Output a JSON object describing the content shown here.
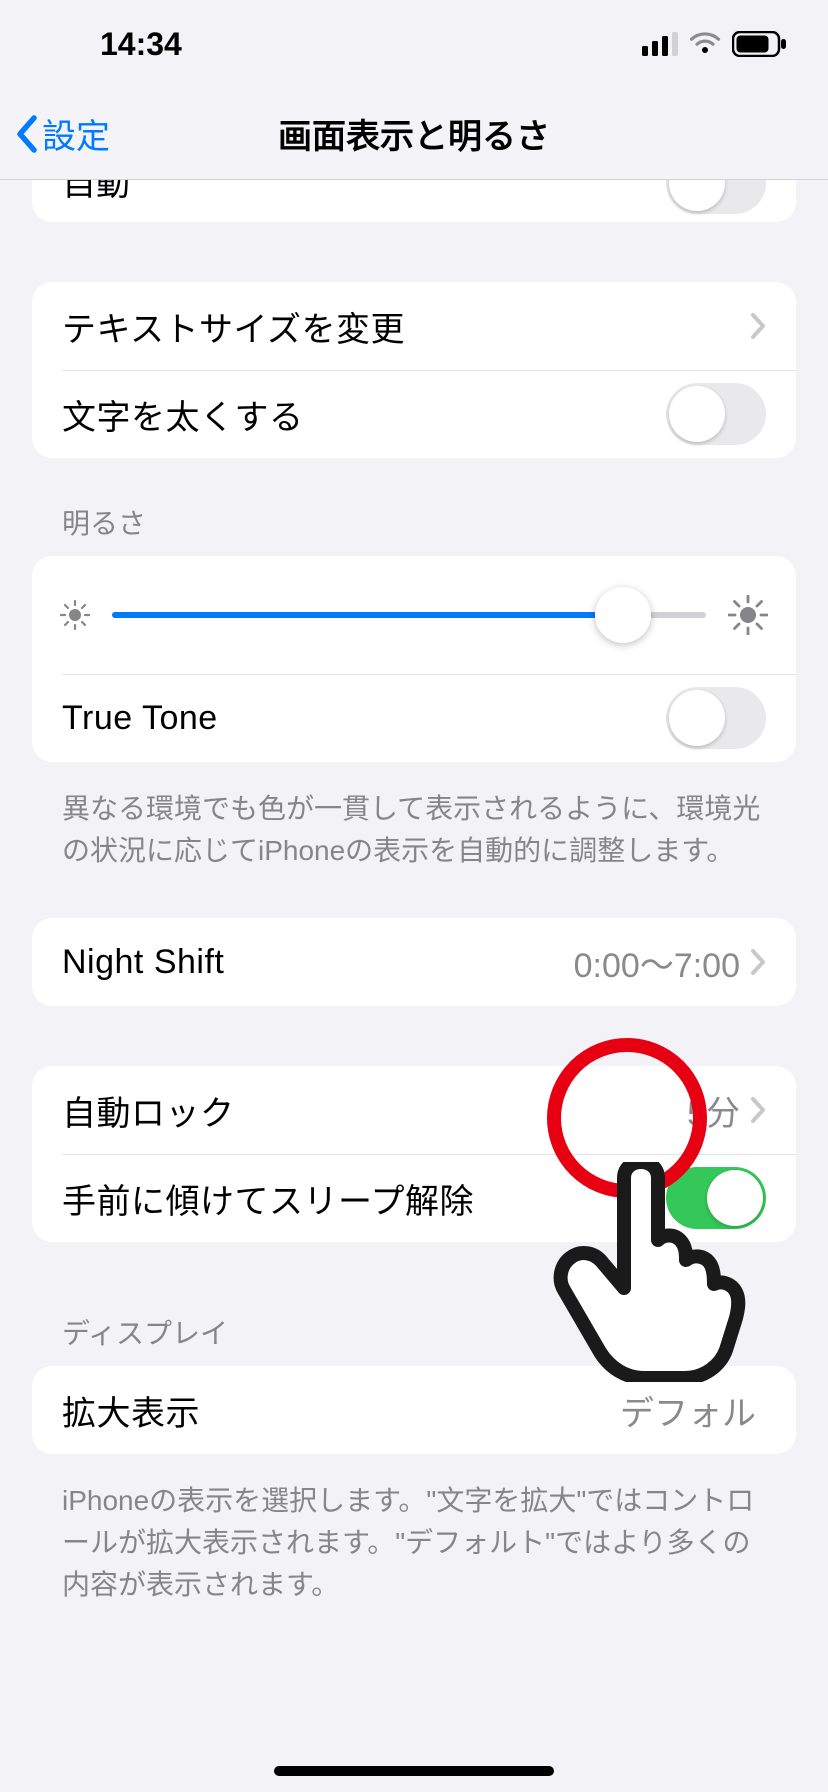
{
  "statusbar": {
    "time": "14:34"
  },
  "nav": {
    "back": "設定",
    "title": "画面表示と明るさ"
  },
  "peek": {
    "label": "自動"
  },
  "textGroup": {
    "textSize": "テキストサイズを変更",
    "bold": "文字を太くする"
  },
  "brightness": {
    "header": "明るさ",
    "trueTone": "True Tone",
    "footer": "異なる環境でも色が一貫して表示されるように、環境光の状況に応じてiPhoneの表示を自動的に調整します。",
    "sliderPercent": 86
  },
  "nightShift": {
    "label": "Night Shift",
    "value": "0:00～7:00"
  },
  "lock": {
    "autoLock": "自動ロック",
    "autoLockValue": "5分",
    "raiseToWake": "手前に傾けてスリープ解除"
  },
  "display": {
    "header": "ディスプレイ",
    "zoom": "拡大表示",
    "zoomValue": "デフォル",
    "footer": "iPhoneの表示を選択します。\"文字を拡大\"ではコントロールが拡大表示されます。\"デフォルト\"ではより多くの内容が表示されます。"
  }
}
